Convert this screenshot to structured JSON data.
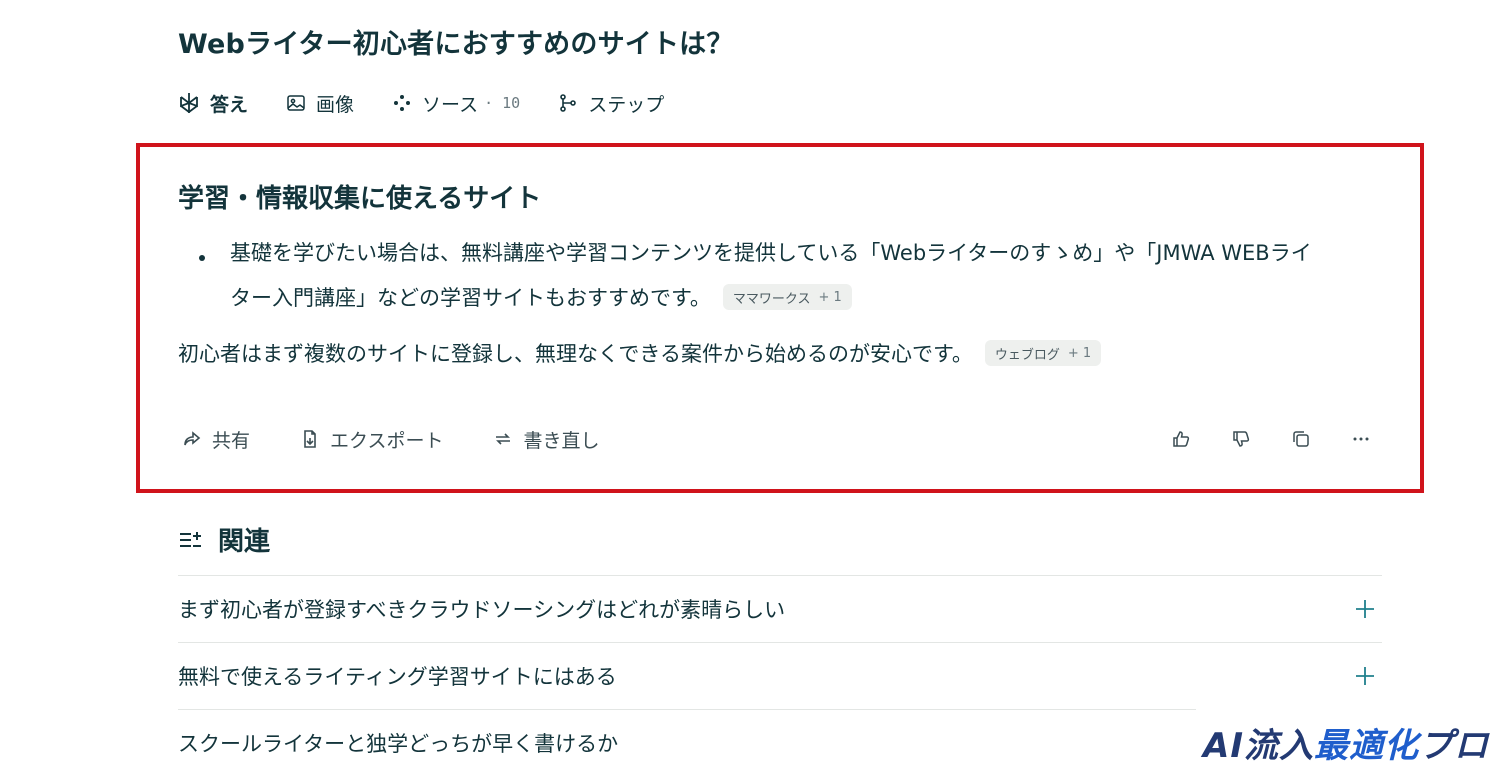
{
  "query": {
    "title": "Webライター初心者におすすめのサイトは？"
  },
  "tabs": [
    {
      "label": "答え",
      "icon": "perplexity-answer-icon",
      "active": true
    },
    {
      "label": "画像",
      "icon": "image-icon"
    },
    {
      "label": "ソース",
      "count": "· 10",
      "icon": "sources-icon"
    },
    {
      "label": "ステップ",
      "icon": "steps-icon"
    }
  ],
  "answer": {
    "heading": "学習・情報収集に使えるサイト",
    "bullet_line1": "基礎を学びたい場合は、無料講座や学習コンテンツを提供している「Webライターのすゝめ」や「JMWA WEBライ",
    "bullet_line2": "ター入門講座」などの学習サイトもおすすめです。",
    "bullet_citation": {
      "source": "ママワークス",
      "plus": "+ 1"
    },
    "paragraph": "初心者はまず複数のサイトに登録し、無理なくできる案件から始めるのが安心です。",
    "paragraph_citation": {
      "source": "ウェブログ",
      "plus": "+ 1"
    }
  },
  "actions": {
    "share": "共有",
    "export": "エクスポート",
    "rewrite": "書き直し",
    "right_icons": [
      "thumbs-up-icon",
      "thumbs-down-icon",
      "copy-icon",
      "more-icon"
    ]
  },
  "related": {
    "title": "関連",
    "items": [
      "まず初心者が登録すべきクラウドソーシングはどれが素晴らしい",
      "無料で使えるライティング学習サイトにはある",
      "スクールライターと独学どっちが早く書けるか"
    ]
  },
  "brand": {
    "part1": "AI流入",
    "part2": "最適化",
    "part3": "プロ"
  },
  "colors": {
    "text": "#13343b",
    "highlight_border": "#d0131b",
    "accent": "#20808d",
    "citation_bg": "#eef0ee"
  }
}
